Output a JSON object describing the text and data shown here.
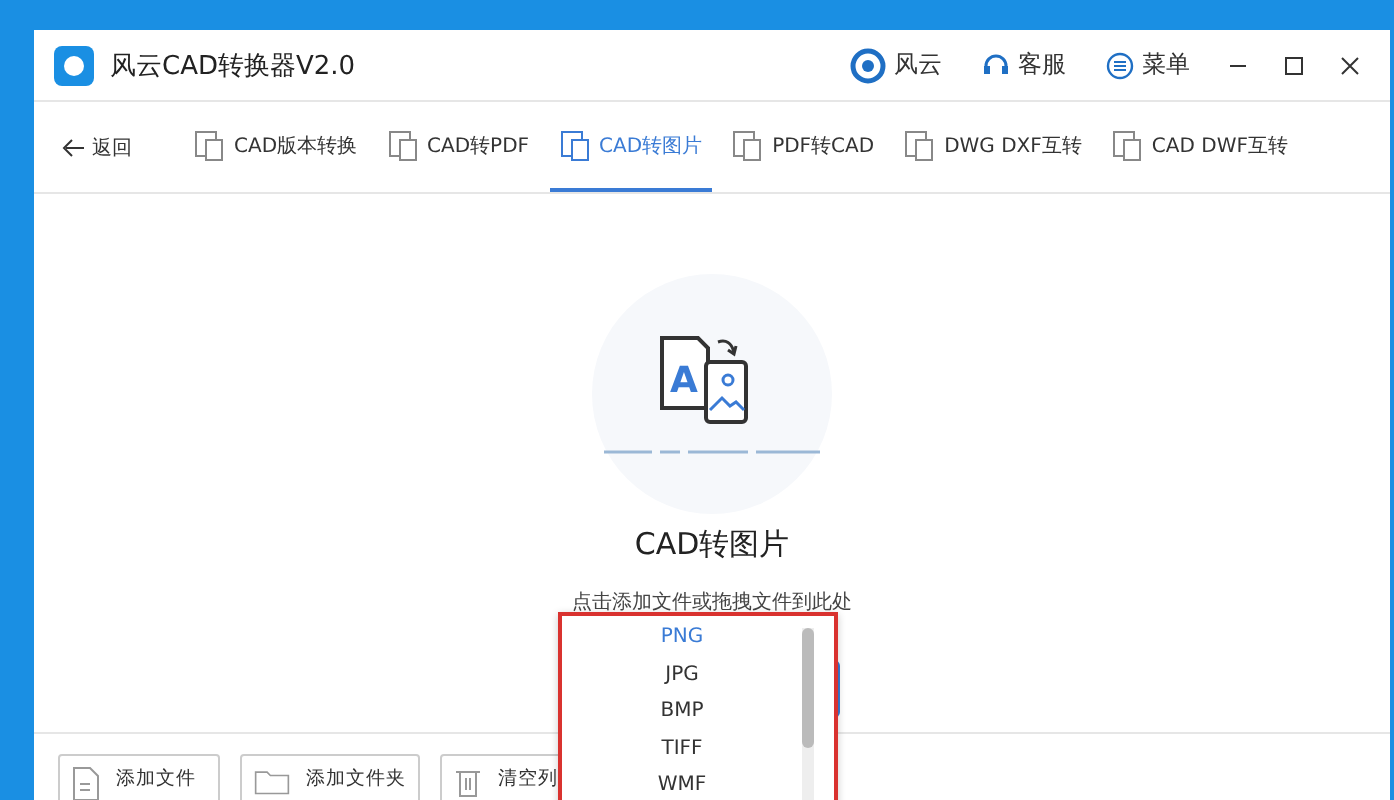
{
  "window": {
    "title": "风云CAD转换器V2.0",
    "header_links": [
      {
        "kind": "brand",
        "label": "风云"
      },
      {
        "kind": "service",
        "label": "客服"
      },
      {
        "kind": "menu",
        "label": "菜单"
      }
    ]
  },
  "nav": {
    "back": "返回",
    "tabs": [
      {
        "label": "CAD版本转换",
        "selected": false
      },
      {
        "label": "CAD转PDF",
        "selected": false
      },
      {
        "label": "CAD转图片",
        "selected": true
      },
      {
        "label": "PDF转CAD",
        "selected": false
      },
      {
        "label": "DWG DXF互转",
        "selected": false
      },
      {
        "label": "CAD DWF互转",
        "selected": false
      }
    ]
  },
  "drop_zone": {
    "icon_letter": "A",
    "title": "CAD转图片",
    "hint": "点击添加文件或拖拽文件到此处"
  },
  "format_dropdown": {
    "options": [
      {
        "label": "PNG",
        "selected": true
      },
      {
        "label": "JPG",
        "selected": false
      },
      {
        "label": "BMP",
        "selected": false
      },
      {
        "label": "TIFF",
        "selected": false
      },
      {
        "label": "WMF",
        "selected": false
      }
    ]
  },
  "toolbar": [
    {
      "kind": "file",
      "label": "添加文件"
    },
    {
      "kind": "folder",
      "label": "添加文件夹"
    },
    {
      "kind": "trash",
      "label": "清空列"
    }
  ]
}
